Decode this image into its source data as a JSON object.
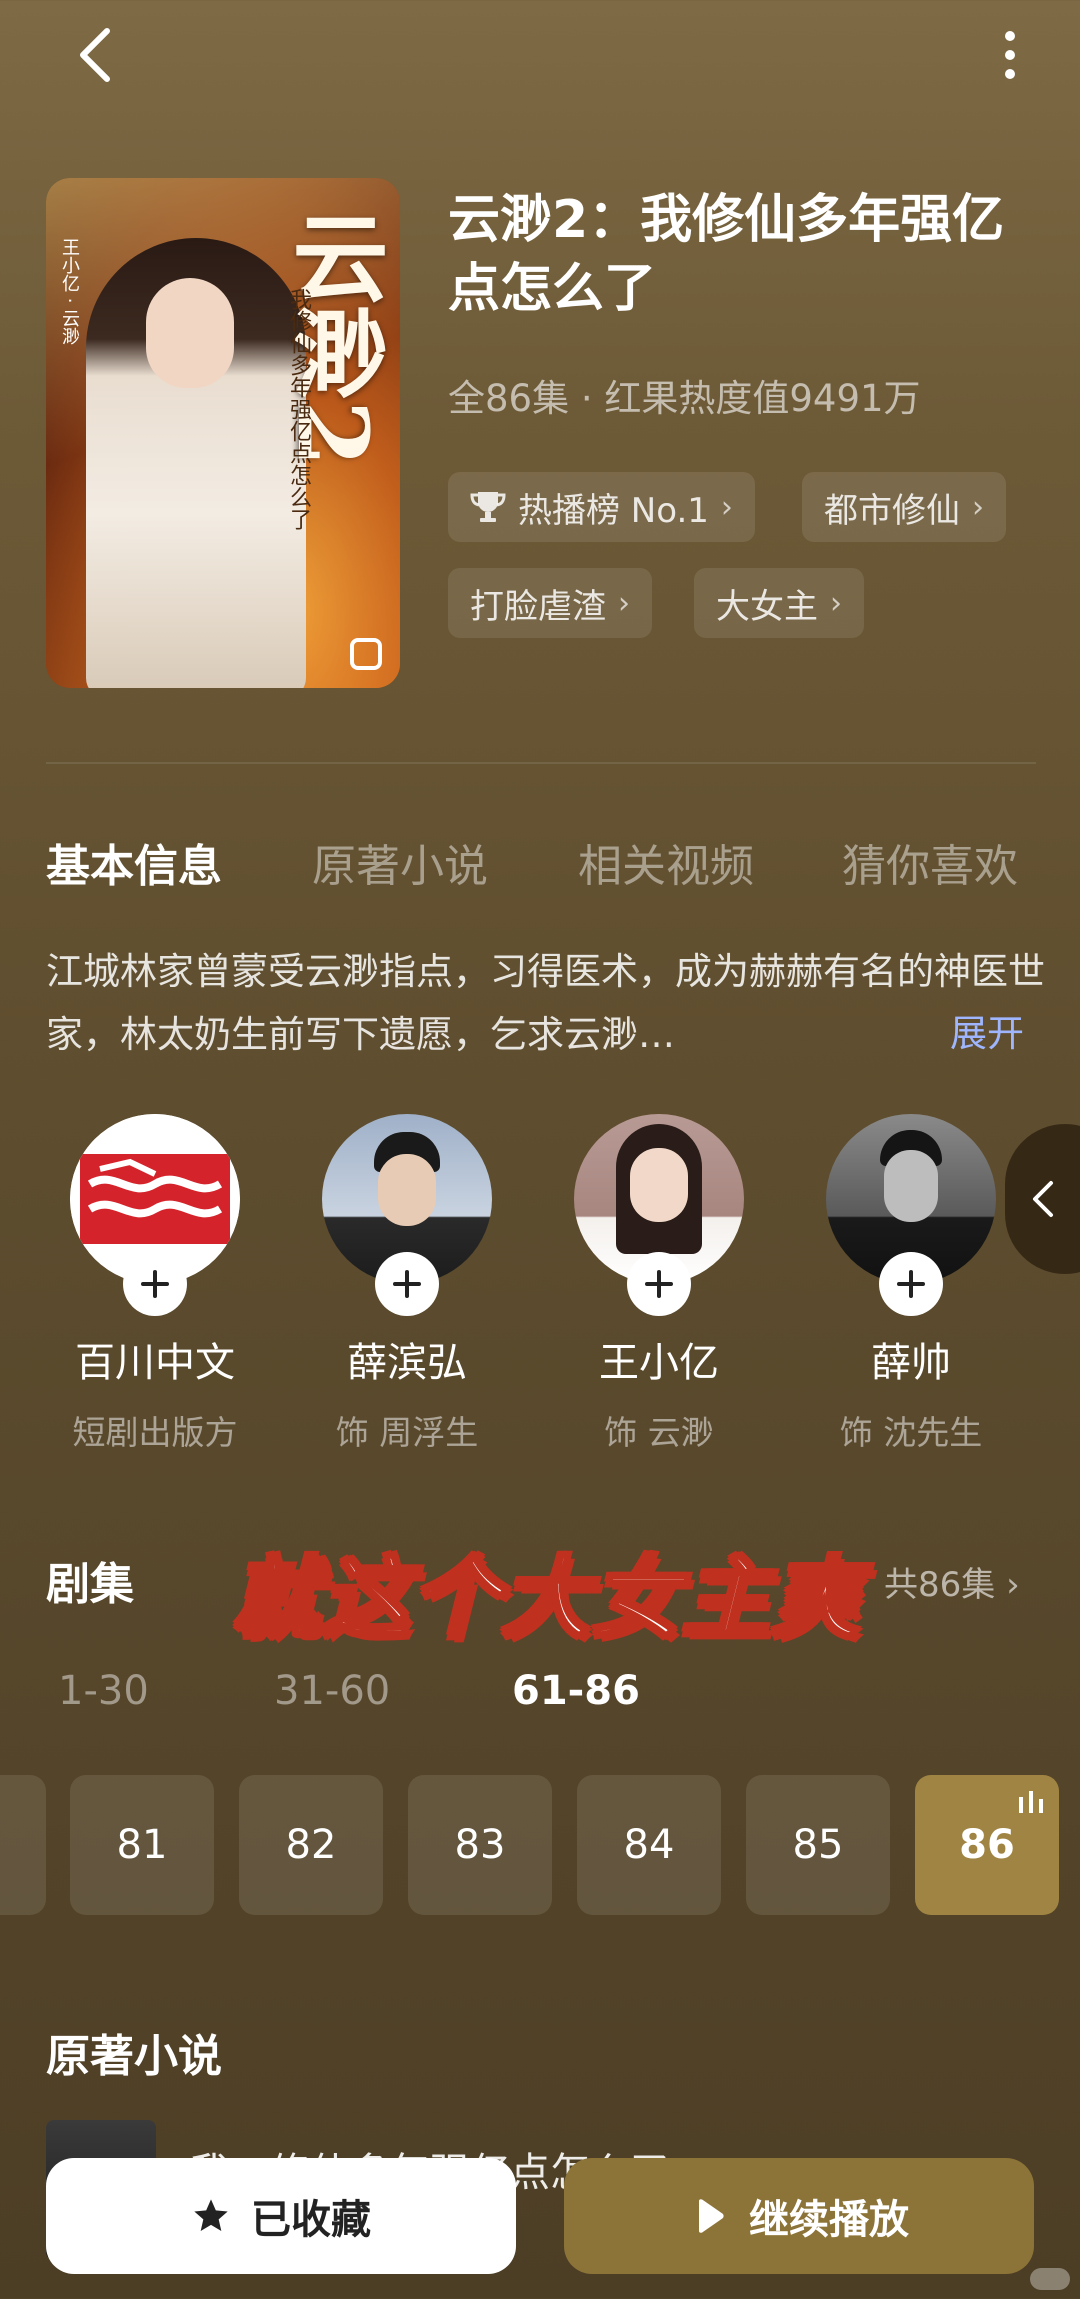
{
  "header": {
    "back_icon": "chevron-left-icon",
    "more_icon": "more-vertical-icon"
  },
  "poster": {
    "art_title": "云渺2",
    "art_subtitle": "我修仙多年强亿点怎么了",
    "art_credit": "王小亿 · 云渺"
  },
  "drama": {
    "title": "云渺2：我修仙多年强亿点怎么了",
    "meta": "全86集 · 红果热度值9491万",
    "tags": [
      {
        "label": "热播榜 No.1",
        "icon": "trophy-icon"
      },
      {
        "label": "都市修仙"
      },
      {
        "label": "打脸虐渣"
      },
      {
        "label": "大女主"
      }
    ]
  },
  "tabs": [
    "基本信息",
    "原著小说",
    "相关视频",
    "猜你喜欢"
  ],
  "description": {
    "text": "江城林家曾蒙受云渺指点，习得医术，成为赫赫有名的神医世家，林太奶生前写下遗愿，乞求云渺…",
    "expand_label": "展开"
  },
  "cast": [
    {
      "name": "百川中文",
      "role": "短剧出版方"
    },
    {
      "name": "薛滨弘",
      "role": "饰 周浮生"
    },
    {
      "name": "王小亿",
      "role": "饰 云渺"
    },
    {
      "name": "薛帅",
      "role": "饰 沈先生"
    }
  ],
  "episodes": {
    "title": "剧集",
    "total_label": "共86集",
    "overlay_caption": "就这个大女主爽",
    "ranges": [
      "1-30",
      "31-60",
      "61-86"
    ],
    "active_range": "61-86",
    "buttons": [
      "81",
      "82",
      "83",
      "84",
      "85",
      "86"
    ],
    "active_episode": "86"
  },
  "novel": {
    "section_title": "原著小说",
    "name": "我…修仙多年强亿点怎么了"
  },
  "actions": {
    "collect_label": "已收藏",
    "play_label": "继续播放"
  },
  "colors": {
    "accent": "#a08443",
    "link": "#9fb6ff",
    "overlay_stroke": "#c0301e"
  }
}
